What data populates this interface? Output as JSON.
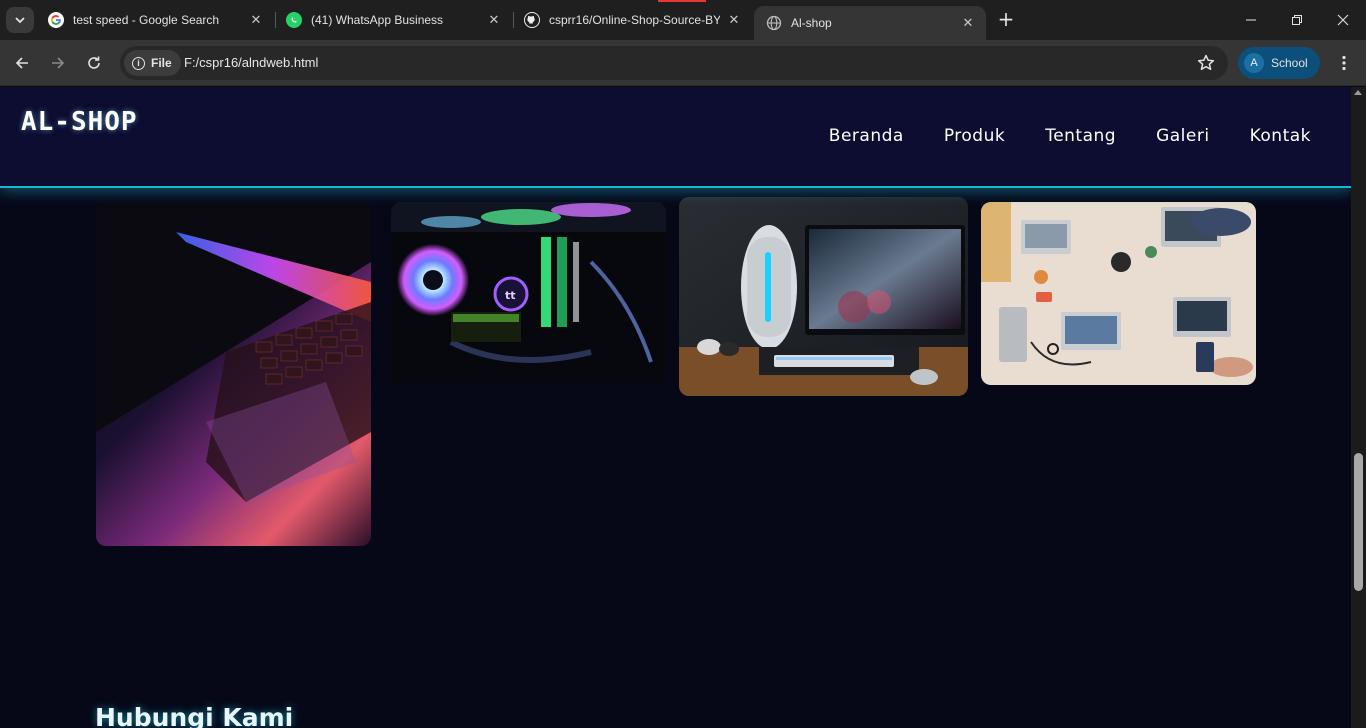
{
  "browser": {
    "tabs": [
      {
        "title": "test speed - Google Search",
        "icon": "google-icon"
      },
      {
        "title": "(41) WhatsApp Business",
        "icon": "whatsapp-icon"
      },
      {
        "title": "csprr16/Online-Shop-Source-BY",
        "icon": "github-icon"
      },
      {
        "title": "Al-shop",
        "icon": "globe-icon",
        "active": true
      }
    ],
    "address": {
      "chip_label": "File",
      "url": "F:/cspr16/alndweb.html"
    },
    "profile_label": "School",
    "profile_initial": "A"
  },
  "site": {
    "logo": "AL-SHOP",
    "nav": [
      "Beranda",
      "Produk",
      "Tentang",
      "Galeri",
      "Kontak"
    ],
    "gallery": [
      {
        "subject": "laptop-keyboard-neon"
      },
      {
        "subject": "rgb-pc-build"
      },
      {
        "subject": "gaming-desk-setup"
      },
      {
        "subject": "team-laptops-table"
      }
    ],
    "contact_title": "Hubungi Kami"
  },
  "colors": {
    "accent": "#18b7d4",
    "header_bg": "#0c0d30",
    "page_bg": "#060818"
  }
}
